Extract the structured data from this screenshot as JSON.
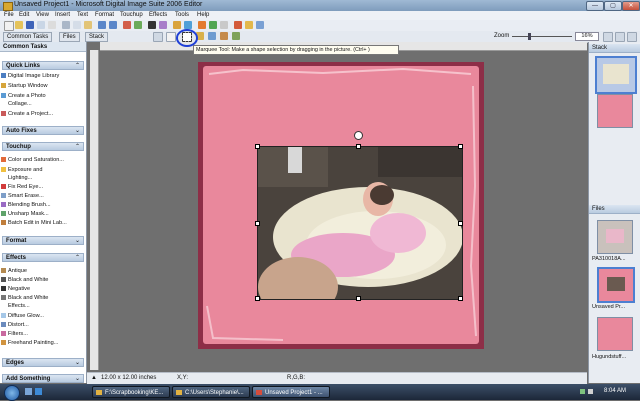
{
  "titlebar": {
    "title": "Unsaved Project1 - Microsoft Digital Image Suite 2006 Editor",
    "minimize": "—",
    "maximize": "▢",
    "close": "✕"
  },
  "menu": [
    "File",
    "Edit",
    "View",
    "Insert",
    "Text",
    "Format",
    "Touchup",
    "Effects",
    "Tools",
    "Help"
  ],
  "toolbar2": {
    "tab_common": "Common Tasks",
    "tab_files": "Files",
    "tab_stack": "Stack",
    "zoom_label": "Zoom",
    "zoom_value": "16%"
  },
  "tooltip": "Marquee Tool: Make a shape selection by dragging in the picture.   (Ctrl+ )",
  "left_panel": {
    "header": "Common Tasks",
    "sections": [
      {
        "title": "Quick Links",
        "items": [
          "Digital Image Library",
          "Startup Window",
          "Create a Photo",
          "Collage...",
          "Create a Project..."
        ]
      },
      {
        "title": "Auto Fixes",
        "items": []
      },
      {
        "title": "Touchup",
        "items": [
          "Color and Saturation...",
          "Exposure and",
          "Lighting...",
          "Fix Red Eye...",
          "Smart Erase...",
          "Blending Brush...",
          "Unsharp Mask...",
          "Batch Edit in Mini Lab..."
        ]
      },
      {
        "title": "Format",
        "items": []
      },
      {
        "title": "Effects",
        "items": [
          "Antique",
          "Black and White",
          "Negative",
          "Black and White",
          "Effects...",
          "Diffuse Glow...",
          "Distort...",
          "Filters...",
          "Freehand Painting..."
        ]
      },
      {
        "title": "Edges",
        "items": []
      },
      {
        "title": "Add Something",
        "items": []
      }
    ]
  },
  "statusbar": {
    "size": "12.00 x 12.00 inches",
    "xy": "X,Y:",
    "rgb": "R,G,B:"
  },
  "right_panel": {
    "stack_header": "Stack",
    "files_header": "Files",
    "files": [
      "PA310018A...",
      "Unsaved Pr...",
      "Hugundstuff..."
    ]
  },
  "taskbar": {
    "tasks": [
      "F:\\Scrapbooking\\KE...",
      "C:\\Users\\Stephanie\\...",
      "Unsaved Project1 - ..."
    ],
    "time": "8:04 AM"
  },
  "colors": {
    "frame": "#8d2e47",
    "page": "#e9889c",
    "accent_circle": "#1f3fd6"
  }
}
